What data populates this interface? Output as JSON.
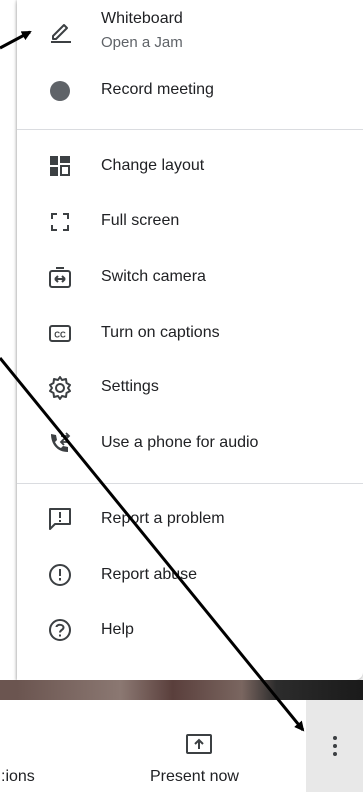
{
  "menu": {
    "whiteboard": {
      "label": "Whiteboard",
      "sublabel": "Open a Jam",
      "icon": "pencil-icon"
    },
    "record": {
      "label": "Record meeting",
      "icon": "record-dot-icon"
    },
    "change_layout": {
      "label": "Change layout",
      "icon": "layout-icon"
    },
    "full_screen": {
      "label": "Full screen",
      "icon": "fullscreen-icon"
    },
    "switch_camera": {
      "label": "Switch camera",
      "icon": "switch-camera-icon"
    },
    "captions": {
      "label": "Turn on captions",
      "icon": "captions-icon"
    },
    "settings": {
      "label": "Settings",
      "icon": "gear-icon"
    },
    "phone_audio": {
      "label": "Use a phone for audio",
      "icon": "phone-audio-icon"
    },
    "report_problem": {
      "label": "Report a problem",
      "icon": "feedback-icon"
    },
    "report_abuse": {
      "label": "Report abuse",
      "icon": "alert-circle-icon"
    },
    "help": {
      "label": "Help",
      "icon": "help-icon"
    }
  },
  "bottom_bar": {
    "activities_partial": ":ions",
    "present_now": "Present now",
    "more_options_icon": "more-vert-icon"
  },
  "colors": {
    "text": "#202124",
    "secondary_text": "#5f6368",
    "icon": "#3c4043",
    "divider": "#dadce0",
    "more_button_bg": "#e8e8e8",
    "annotation_arrow": "#000000"
  }
}
